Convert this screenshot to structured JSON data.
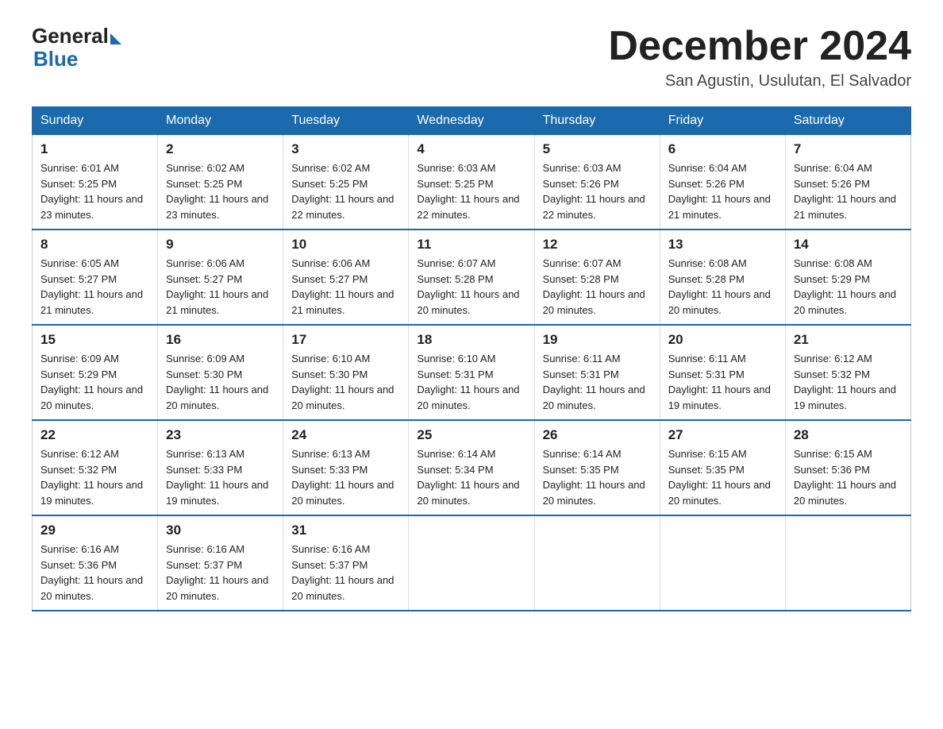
{
  "logo": {
    "general": "General",
    "blue": "Blue"
  },
  "title": "December 2024",
  "location": "San Agustin, Usulutan, El Salvador",
  "days_of_week": [
    "Sunday",
    "Monday",
    "Tuesday",
    "Wednesday",
    "Thursday",
    "Friday",
    "Saturday"
  ],
  "weeks": [
    [
      {
        "day": "1",
        "sunrise": "6:01 AM",
        "sunset": "5:25 PM",
        "daylight": "11 hours and 23 minutes."
      },
      {
        "day": "2",
        "sunrise": "6:02 AM",
        "sunset": "5:25 PM",
        "daylight": "11 hours and 23 minutes."
      },
      {
        "day": "3",
        "sunrise": "6:02 AM",
        "sunset": "5:25 PM",
        "daylight": "11 hours and 22 minutes."
      },
      {
        "day": "4",
        "sunrise": "6:03 AM",
        "sunset": "5:25 PM",
        "daylight": "11 hours and 22 minutes."
      },
      {
        "day": "5",
        "sunrise": "6:03 AM",
        "sunset": "5:26 PM",
        "daylight": "11 hours and 22 minutes."
      },
      {
        "day": "6",
        "sunrise": "6:04 AM",
        "sunset": "5:26 PM",
        "daylight": "11 hours and 21 minutes."
      },
      {
        "day": "7",
        "sunrise": "6:04 AM",
        "sunset": "5:26 PM",
        "daylight": "11 hours and 21 minutes."
      }
    ],
    [
      {
        "day": "8",
        "sunrise": "6:05 AM",
        "sunset": "5:27 PM",
        "daylight": "11 hours and 21 minutes."
      },
      {
        "day": "9",
        "sunrise": "6:06 AM",
        "sunset": "5:27 PM",
        "daylight": "11 hours and 21 minutes."
      },
      {
        "day": "10",
        "sunrise": "6:06 AM",
        "sunset": "5:27 PM",
        "daylight": "11 hours and 21 minutes."
      },
      {
        "day": "11",
        "sunrise": "6:07 AM",
        "sunset": "5:28 PM",
        "daylight": "11 hours and 20 minutes."
      },
      {
        "day": "12",
        "sunrise": "6:07 AM",
        "sunset": "5:28 PM",
        "daylight": "11 hours and 20 minutes."
      },
      {
        "day": "13",
        "sunrise": "6:08 AM",
        "sunset": "5:28 PM",
        "daylight": "11 hours and 20 minutes."
      },
      {
        "day": "14",
        "sunrise": "6:08 AM",
        "sunset": "5:29 PM",
        "daylight": "11 hours and 20 minutes."
      }
    ],
    [
      {
        "day": "15",
        "sunrise": "6:09 AM",
        "sunset": "5:29 PM",
        "daylight": "11 hours and 20 minutes."
      },
      {
        "day": "16",
        "sunrise": "6:09 AM",
        "sunset": "5:30 PM",
        "daylight": "11 hours and 20 minutes."
      },
      {
        "day": "17",
        "sunrise": "6:10 AM",
        "sunset": "5:30 PM",
        "daylight": "11 hours and 20 minutes."
      },
      {
        "day": "18",
        "sunrise": "6:10 AM",
        "sunset": "5:31 PM",
        "daylight": "11 hours and 20 minutes."
      },
      {
        "day": "19",
        "sunrise": "6:11 AM",
        "sunset": "5:31 PM",
        "daylight": "11 hours and 20 minutes."
      },
      {
        "day": "20",
        "sunrise": "6:11 AM",
        "sunset": "5:31 PM",
        "daylight": "11 hours and 19 minutes."
      },
      {
        "day": "21",
        "sunrise": "6:12 AM",
        "sunset": "5:32 PM",
        "daylight": "11 hours and 19 minutes."
      }
    ],
    [
      {
        "day": "22",
        "sunrise": "6:12 AM",
        "sunset": "5:32 PM",
        "daylight": "11 hours and 19 minutes."
      },
      {
        "day": "23",
        "sunrise": "6:13 AM",
        "sunset": "5:33 PM",
        "daylight": "11 hours and 19 minutes."
      },
      {
        "day": "24",
        "sunrise": "6:13 AM",
        "sunset": "5:33 PM",
        "daylight": "11 hours and 20 minutes."
      },
      {
        "day": "25",
        "sunrise": "6:14 AM",
        "sunset": "5:34 PM",
        "daylight": "11 hours and 20 minutes."
      },
      {
        "day": "26",
        "sunrise": "6:14 AM",
        "sunset": "5:35 PM",
        "daylight": "11 hours and 20 minutes."
      },
      {
        "day": "27",
        "sunrise": "6:15 AM",
        "sunset": "5:35 PM",
        "daylight": "11 hours and 20 minutes."
      },
      {
        "day": "28",
        "sunrise": "6:15 AM",
        "sunset": "5:36 PM",
        "daylight": "11 hours and 20 minutes."
      }
    ],
    [
      {
        "day": "29",
        "sunrise": "6:16 AM",
        "sunset": "5:36 PM",
        "daylight": "11 hours and 20 minutes."
      },
      {
        "day": "30",
        "sunrise": "6:16 AM",
        "sunset": "5:37 PM",
        "daylight": "11 hours and 20 minutes."
      },
      {
        "day": "31",
        "sunrise": "6:16 AM",
        "sunset": "5:37 PM",
        "daylight": "11 hours and 20 minutes."
      },
      null,
      null,
      null,
      null
    ]
  ]
}
